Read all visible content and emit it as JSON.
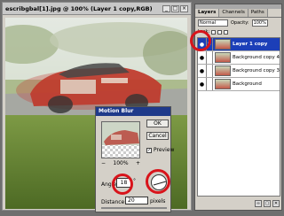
{
  "document": {
    "title": "escribgbal[1].jpg @ 100% (Layer 1 copy,RGB)",
    "window_buttons": [
      "_",
      "□",
      "×"
    ]
  },
  "motion_blur": {
    "title": "Motion Blur",
    "ok_label": "OK",
    "cancel_label": "Cancel",
    "preview_label": "Preview",
    "preview_checked": true,
    "zoom_out": "−",
    "zoom_level": "100%",
    "zoom_in": "+",
    "angle_label": "Angle:",
    "angle_value": "18",
    "angle_unit": "°",
    "distance_label": "Distance:",
    "distance_value": "20",
    "distance_unit": "pixels"
  },
  "layers_panel": {
    "tabs": [
      "Layers",
      "Channels",
      "Paths"
    ],
    "blend_mode": "Normal",
    "opacity_label": "Opacity:",
    "opacity_value": "100%",
    "lock_label": "Lock:",
    "layers": [
      {
        "name": "Layer 1 copy",
        "selected": true
      },
      {
        "name": "Background copy 4",
        "selected": false
      },
      {
        "name": "Background copy 3",
        "selected": false
      },
      {
        "name": "Background",
        "selected": false
      }
    ],
    "bottom_icons": [
      "link-icon",
      "new-layer-icon",
      "trash-icon"
    ]
  },
  "colors": {
    "selection": "#1c3fb8",
    "callout": "#d8141b"
  }
}
